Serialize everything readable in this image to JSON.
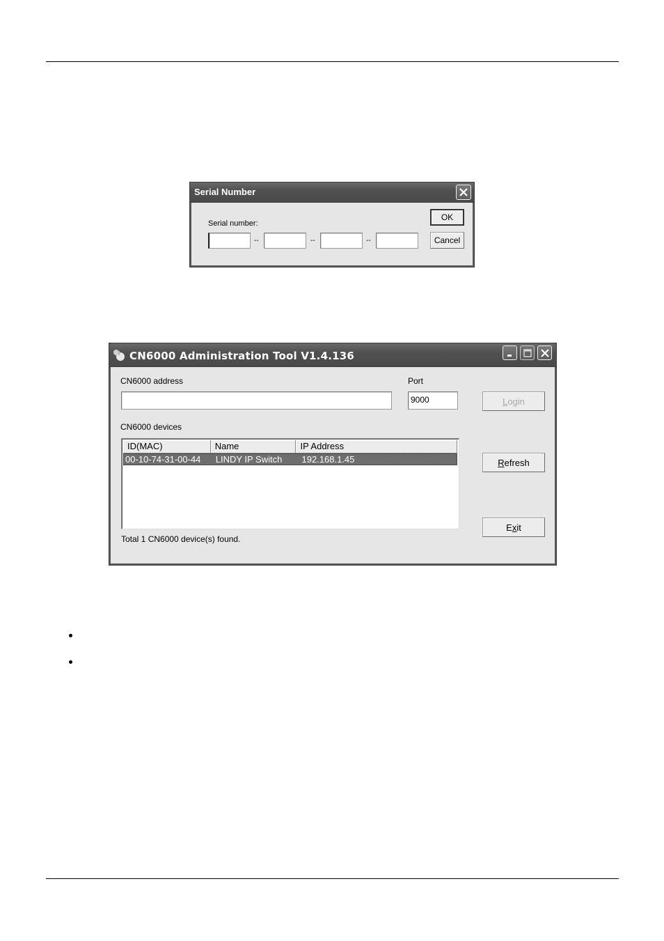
{
  "serial_dialog": {
    "title": "Serial Number",
    "close_icon": "close-icon",
    "label": "Serial number:",
    "fields": [
      "",
      "",
      "",
      ""
    ],
    "separator": "--",
    "ok_label": "OK",
    "cancel_label": "Cancel"
  },
  "admin_window": {
    "title": "CN6000 Administration Tool V1.4.136",
    "app_icon": "app-icon",
    "controls": {
      "minimize": "minimize-icon",
      "maximize": "maximize-icon",
      "close": "close-icon"
    },
    "address_label": "CN6000 address",
    "address_value": "",
    "port_label": "Port",
    "port_value": "9000",
    "devices_label": "CN6000 devices",
    "columns": [
      "ID(MAC)",
      "Name",
      "IP Address"
    ],
    "rows": [
      {
        "mac": "00-10-74-31-00-44",
        "name": "LINDY IP Switch",
        "ip": "192.168.1.45",
        "selected": true
      }
    ],
    "status": "Total 1 CN6000 device(s) found.",
    "buttons": {
      "login": {
        "accel": "L",
        "rest": "ogin",
        "enabled": false
      },
      "refresh": {
        "accel": "R",
        "rest": "efresh",
        "enabled": true
      },
      "exit": {
        "pre": "E",
        "accel": "x",
        "rest": "it",
        "enabled": true
      }
    }
  },
  "bullets": [
    "",
    ""
  ]
}
